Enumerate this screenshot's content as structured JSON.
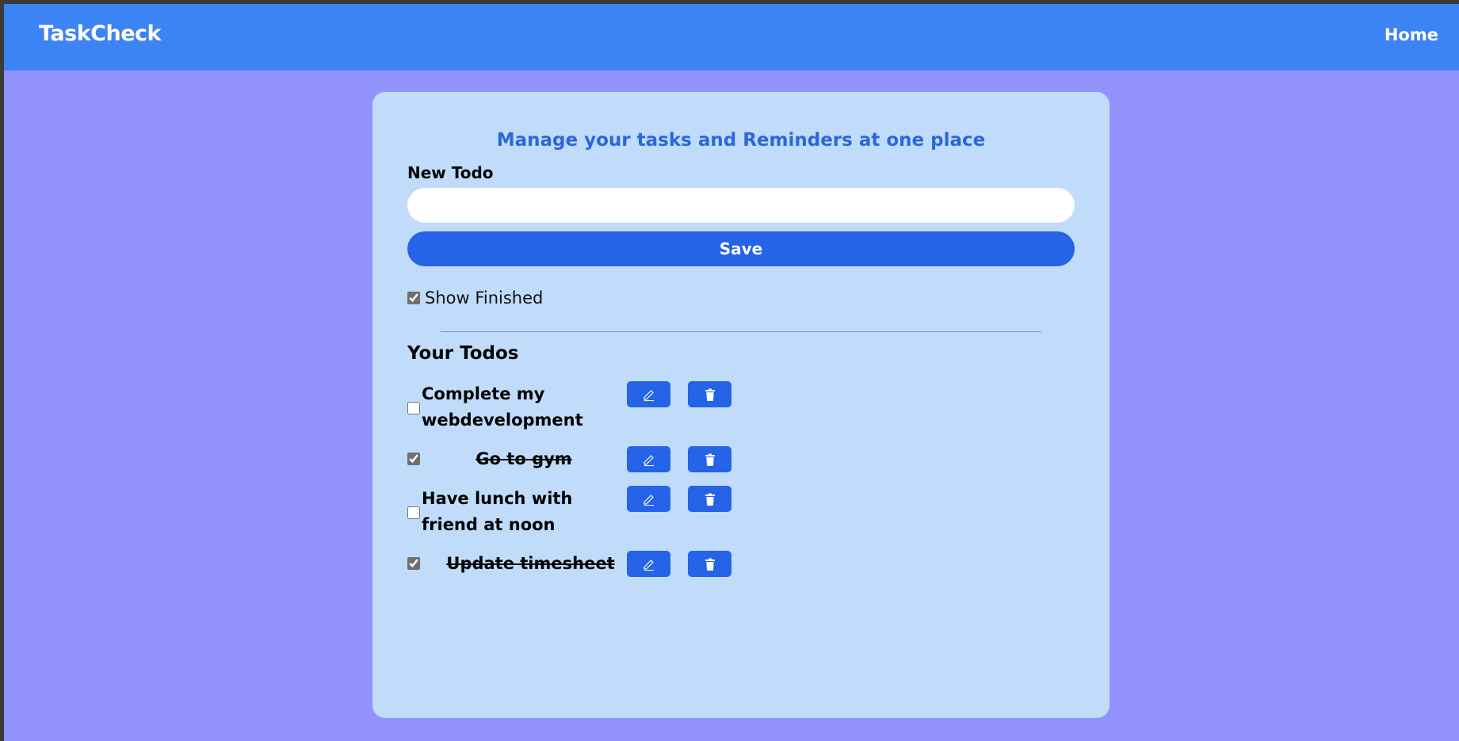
{
  "navbar": {
    "brand": "TaskCheck",
    "home_label": "Home"
  },
  "main": {
    "tagline": "Manage your tasks and Reminders at one place",
    "new_todo_label": "New Todo",
    "new_todo_value": "",
    "save_label": "Save",
    "show_finished_label": "Show Finished",
    "show_finished_checked": true,
    "todos_heading": "Your Todos",
    "todos": [
      {
        "text": "Complete my webdevelopment",
        "done": false
      },
      {
        "text": "Go to gym",
        "done": true
      },
      {
        "text": "Have lunch with friend at noon",
        "done": false
      },
      {
        "text": "Update timesheet",
        "done": true
      }
    ]
  },
  "icons": {
    "edit": "pencil-icon",
    "delete": "trash-icon"
  },
  "colors": {
    "page_bg": "#9292fc",
    "navbar": "#3c83f4",
    "card": "#c0dcfa",
    "accent": "#2563e7",
    "tagline": "#2b66db"
  }
}
